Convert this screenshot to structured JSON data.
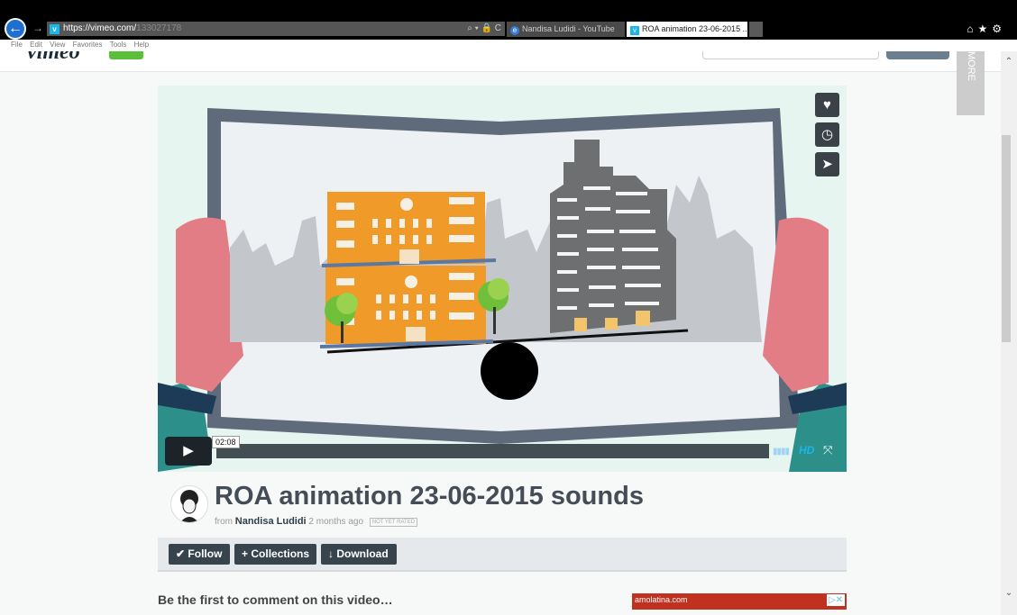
{
  "browser": {
    "url_host": "https://vimeo.com/",
    "url_path": "133027178",
    "address_icons": "⌕ ▾ 🔒 C",
    "tabs": [
      {
        "label": "Nandisa Ludidi - YouTube",
        "active": false
      },
      {
        "label": "ROA animation 23-06-2015 ...",
        "active": true
      }
    ],
    "menu": [
      "File",
      "Edit",
      "View",
      "Favorites",
      "Tools",
      "Help"
    ]
  },
  "sidebar_tab": "MORE VIDEOS",
  "player": {
    "time_tooltip": "02:08",
    "hd_label": "HD",
    "side_buttons": [
      "heart-icon",
      "clock-icon",
      "send-icon"
    ]
  },
  "video_info": {
    "title": "ROA animation 23-06-2015 sounds",
    "from_label": "from",
    "author": "Nandisa Ludidi",
    "posted": "2 months ago",
    "rating_badge": "NOT YET RATED"
  },
  "actions": {
    "follow": "Follow",
    "collections": "Collections",
    "download": "Download"
  },
  "comments": {
    "prompt": "Be the first to comment on this video…"
  },
  "ad": {
    "text": "amolatina.com"
  },
  "colors": {
    "accent": "#1ab7ea",
    "button_dark": "#37444e",
    "building_orange": "#f09a2a",
    "building_gray": "#6d6f70"
  }
}
